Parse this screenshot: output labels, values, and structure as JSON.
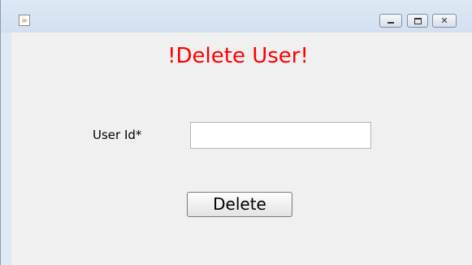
{
  "window": {
    "controls": {
      "minimize": "minimize",
      "maximize": "maximize",
      "close_glyph": "⊠"
    },
    "icon": "java-app-icon"
  },
  "form": {
    "title": "!Delete User!",
    "title_color": "#ff0000",
    "user_id_label": "User Id*",
    "user_id_value": "",
    "user_id_placeholder": "",
    "delete_label": "Delete"
  }
}
